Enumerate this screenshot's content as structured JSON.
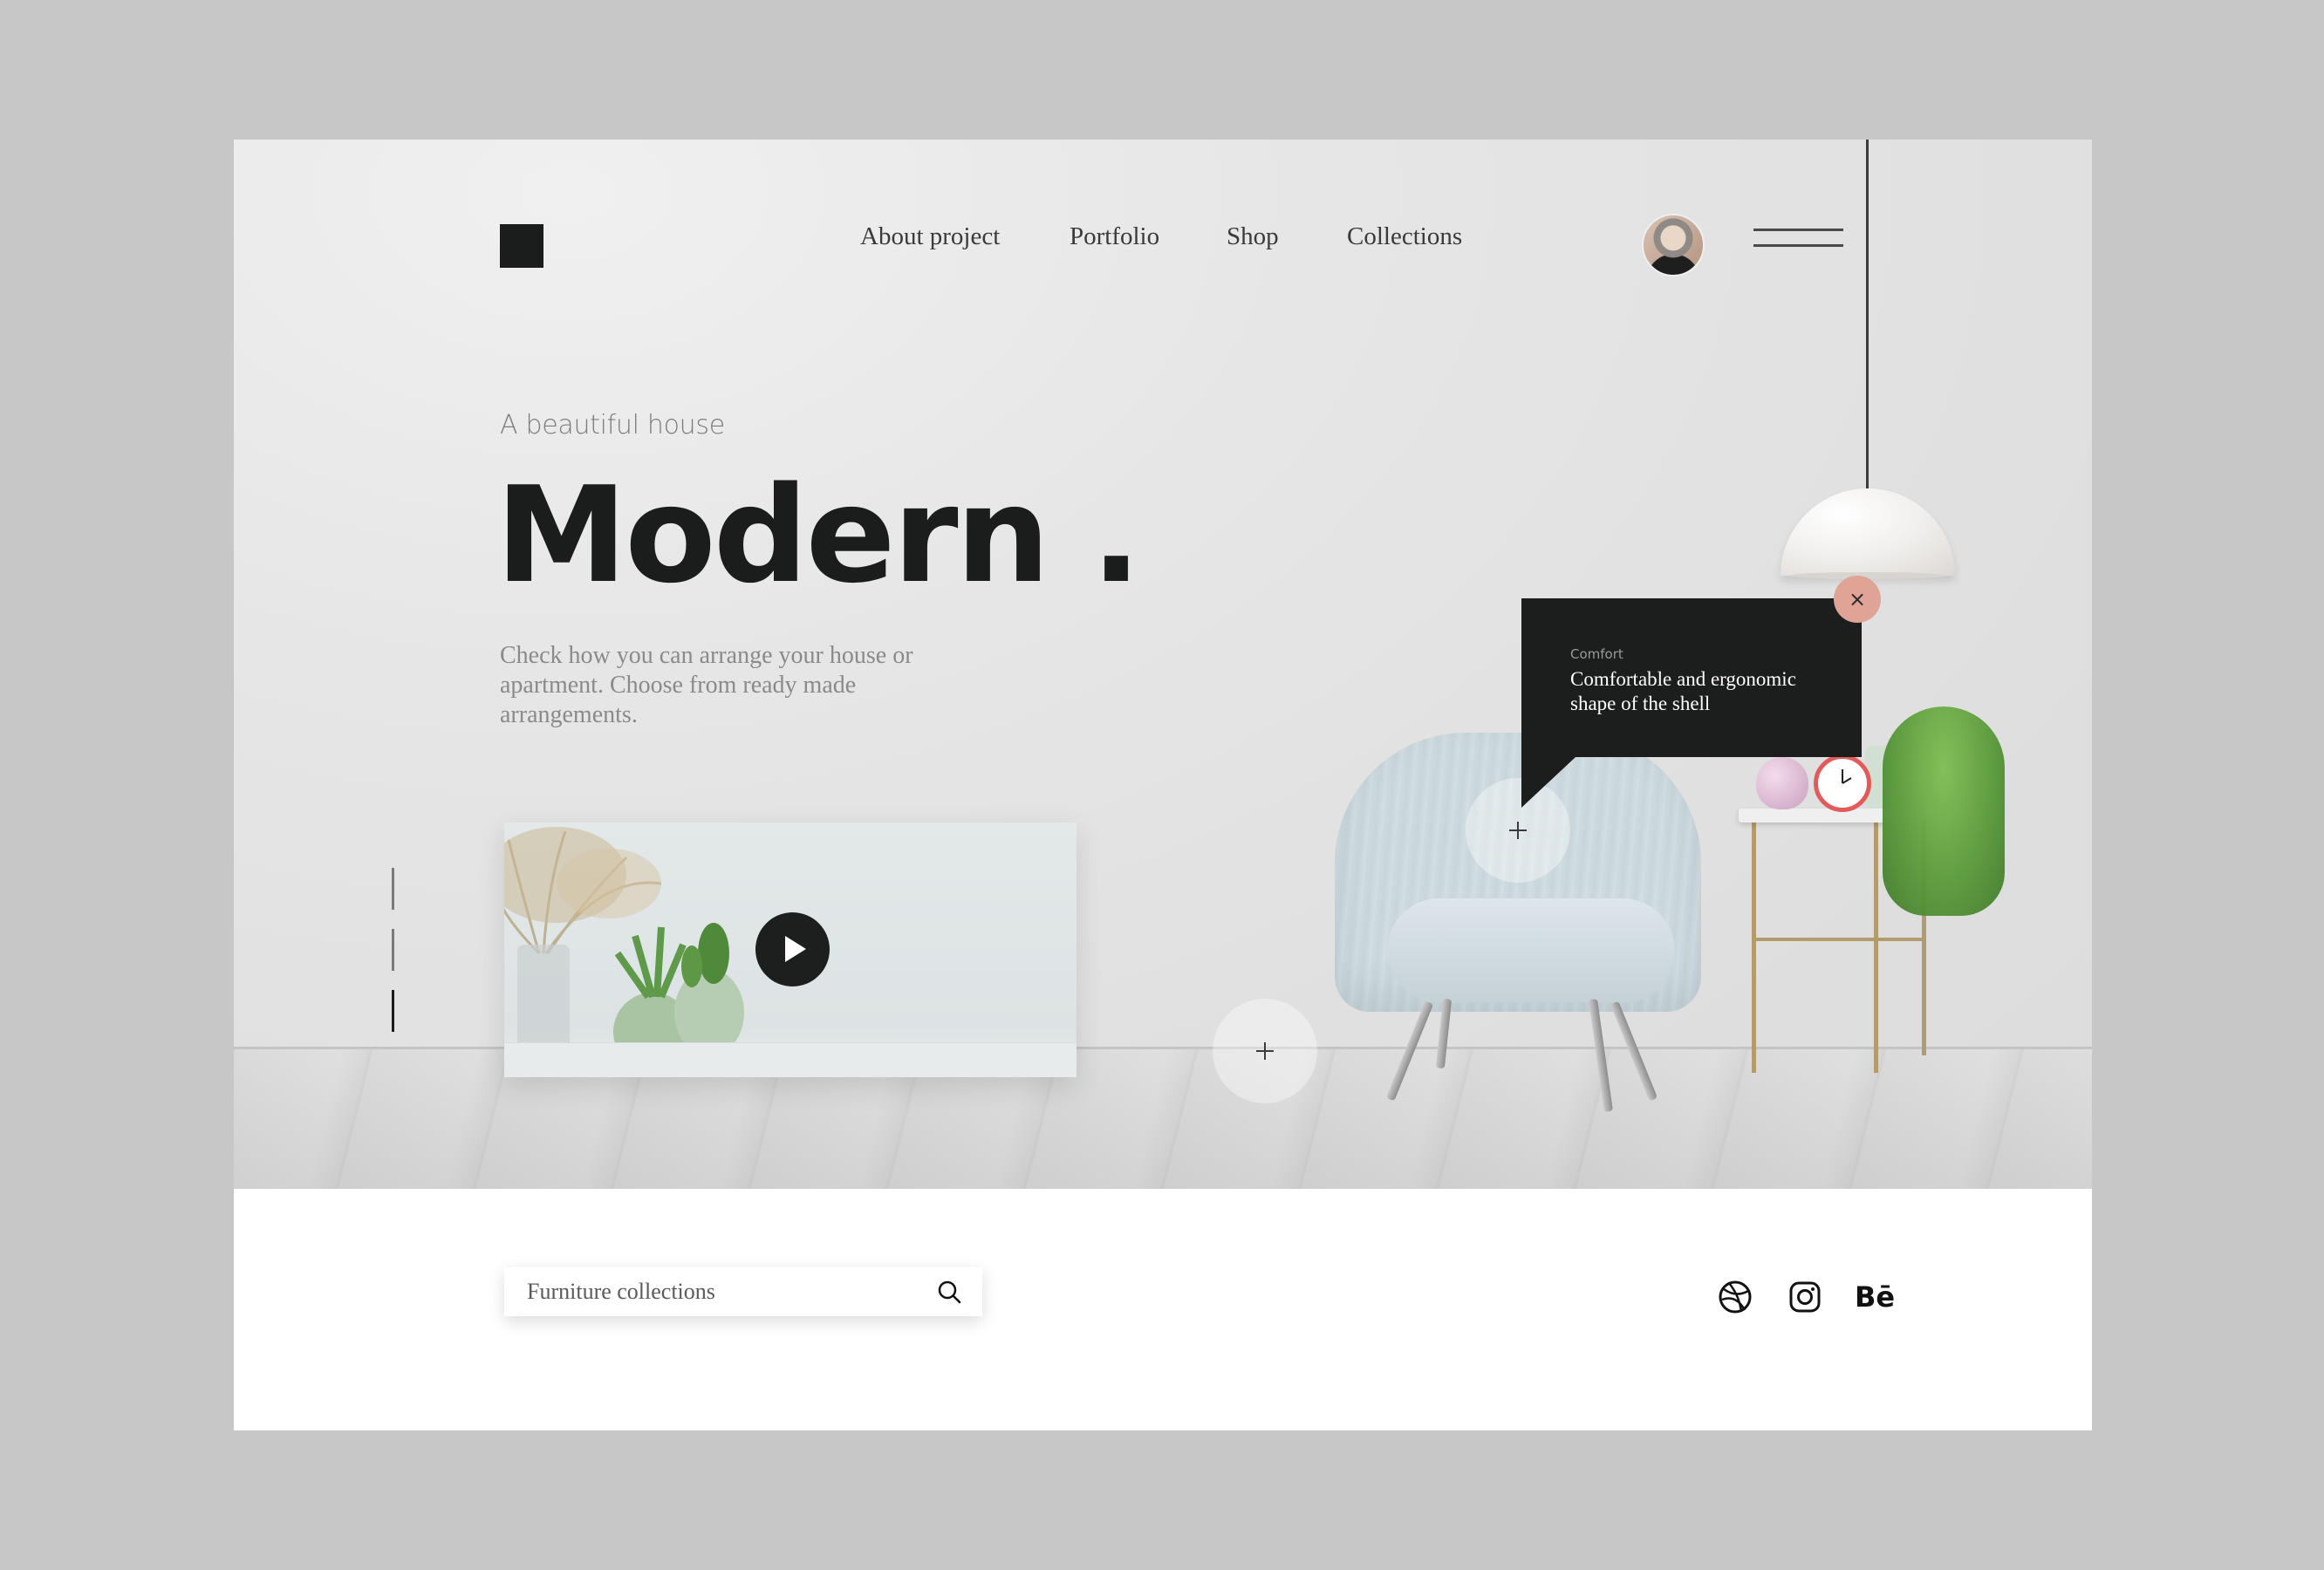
{
  "header": {
    "nav": [
      {
        "label": "About project"
      },
      {
        "label": "Portfolio"
      },
      {
        "label": "Shop"
      },
      {
        "label": "Collections"
      }
    ]
  },
  "hero": {
    "eyebrow": "A beautiful house",
    "headline": "Modern .",
    "lead": "Check how you can arrange your house or apartment. Choose from ready made arrangements."
  },
  "tooltip": {
    "tag": "Comfort",
    "text": "Comfortable and ergonomic shape of the shell",
    "close_icon": "×"
  },
  "search": {
    "placeholder": "Furniture collections"
  },
  "social": {
    "behance_label": "Bē"
  },
  "colors": {
    "accent": "#e0a497",
    "dark": "#1c1d1d",
    "background": "#c7c7c7"
  }
}
